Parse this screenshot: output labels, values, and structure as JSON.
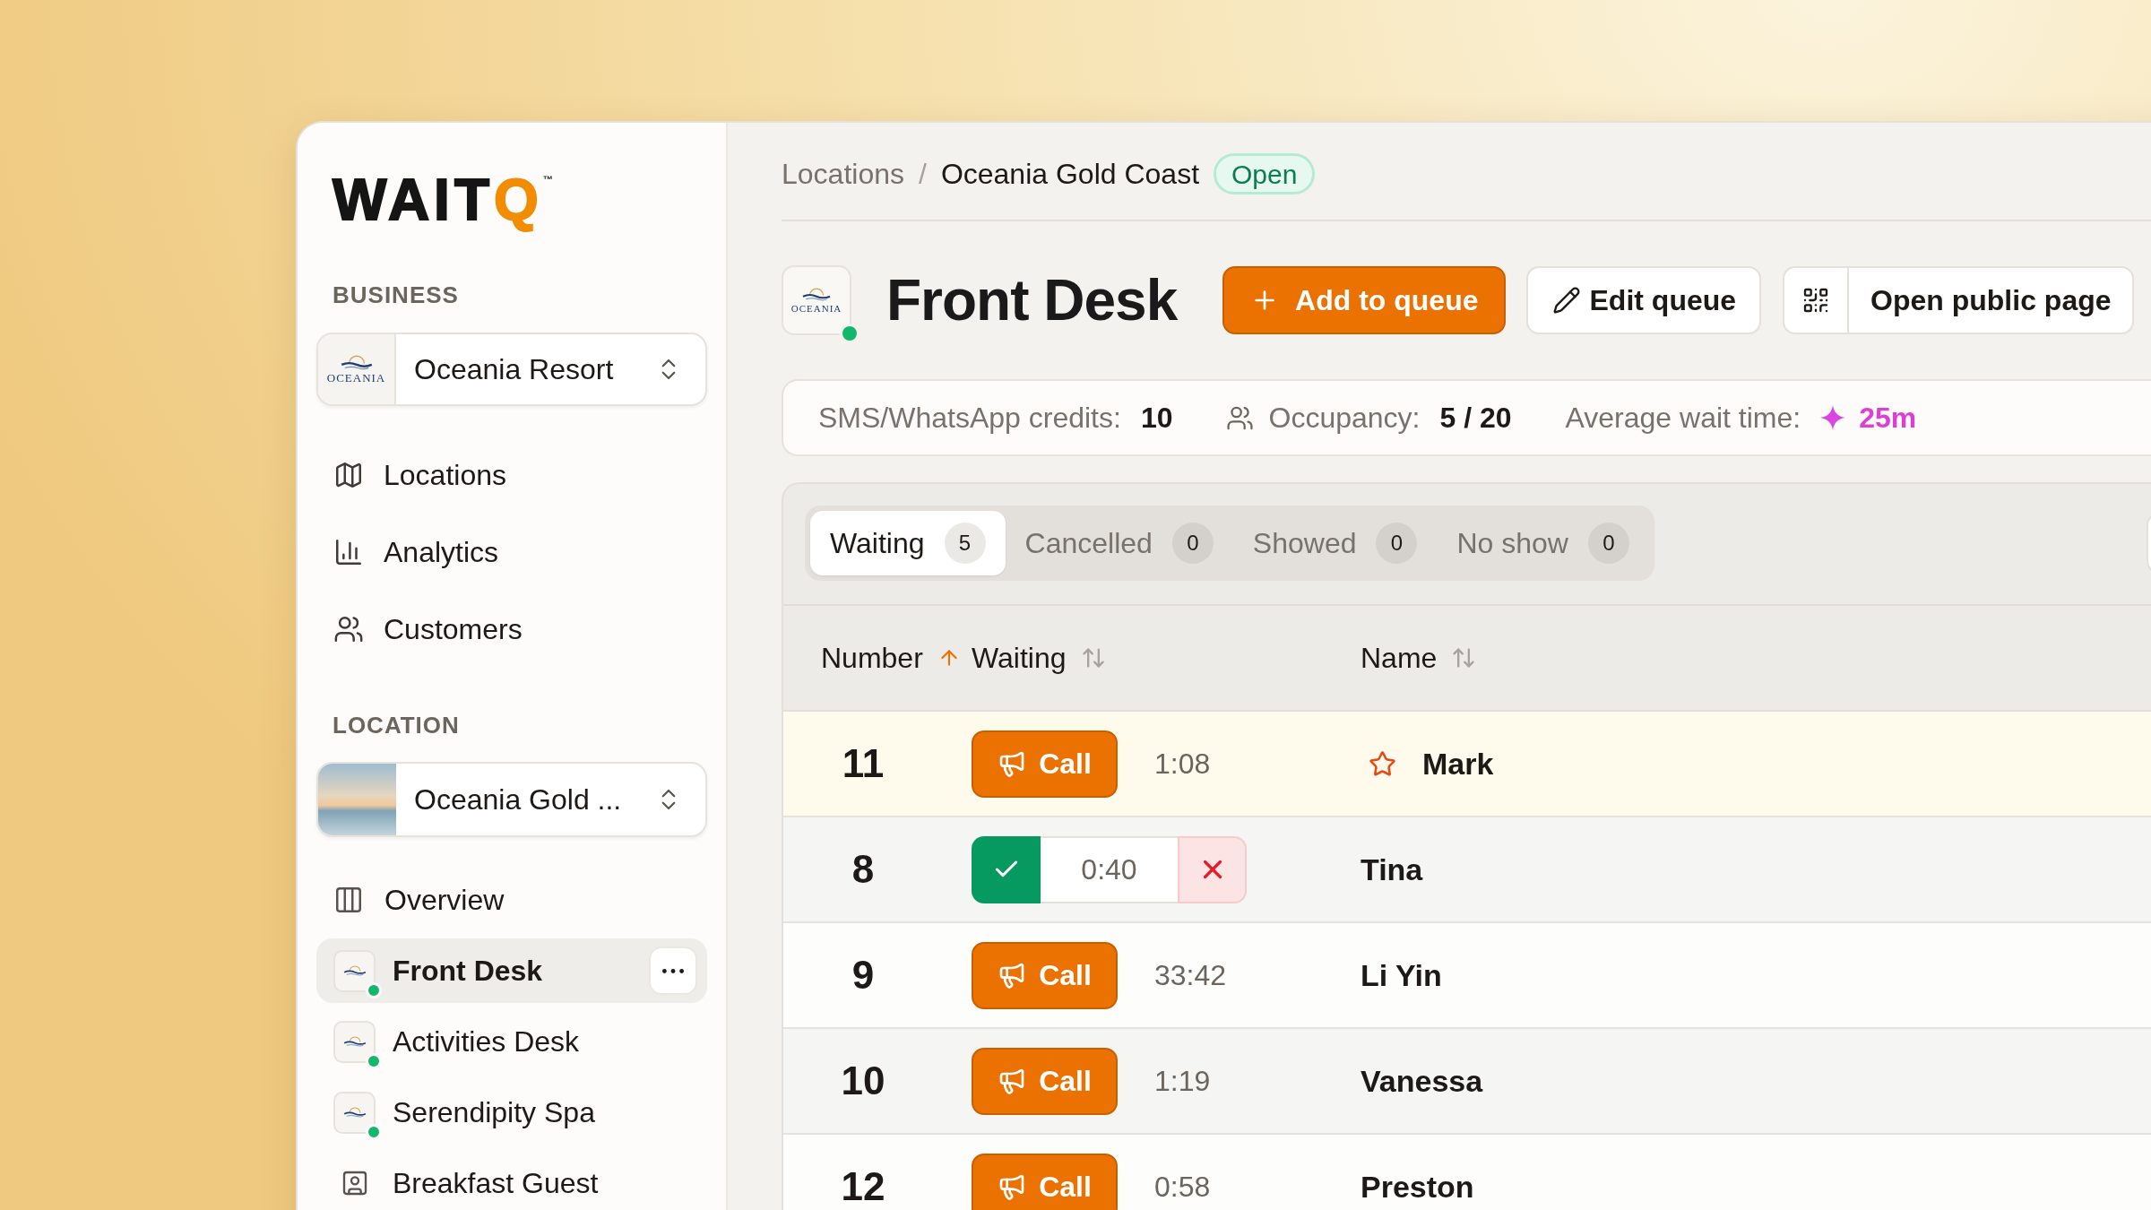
{
  "sidebar": {
    "logo": {
      "text": "WAIT",
      "accent": "Q",
      "mark": "™"
    },
    "business": {
      "label": "BUSINESS",
      "selector": {
        "logo_text": "OCEANIA",
        "value": "Oceania Resort"
      },
      "nav": [
        {
          "label": "Locations",
          "selected": false
        },
        {
          "label": "Analytics",
          "selected": false
        },
        {
          "label": "Customers",
          "selected": false
        }
      ]
    },
    "location": {
      "label": "LOCATION",
      "selector": {
        "value": "Oceania Gold ..."
      },
      "nav": [
        {
          "label": "Overview",
          "kind": "page",
          "selected": false
        },
        {
          "label": "Front Desk",
          "kind": "queue",
          "selected": true,
          "online": true
        },
        {
          "label": "Activities Desk",
          "kind": "queue",
          "selected": false,
          "online": true
        },
        {
          "label": "Serendipity Spa",
          "kind": "queue",
          "selected": false,
          "online": true
        },
        {
          "label": "Breakfast Guest",
          "kind": "list",
          "selected": false
        }
      ]
    }
  },
  "main": {
    "breadcrumb": {
      "items": [
        "Locations",
        "Oceania Gold Coast"
      ],
      "separator": "/",
      "status": "Open"
    },
    "header": {
      "logo_text": "OCEANIA",
      "online": true,
      "title": "Front Desk",
      "buttons": [
        {
          "label": "Add to queue",
          "kind": "primary"
        },
        {
          "label": "Edit queue",
          "kind": "secondary"
        },
        {
          "label": "Open public page",
          "kind": "split"
        }
      ]
    },
    "stats": [
      {
        "label": "SMS/WhatsApp credits:",
        "value": "10",
        "kind": "plain"
      },
      {
        "label": "Occupancy:",
        "value": "5 / 20",
        "kind": "people"
      },
      {
        "label": "Average wait time:",
        "value": "25m",
        "kind": "highlight"
      }
    ],
    "queue": {
      "tabs": [
        {
          "label": "Waiting",
          "count": "5",
          "selected": true
        },
        {
          "label": "Cancelled",
          "count": "0",
          "selected": false
        },
        {
          "label": "Showed",
          "count": "0",
          "selected": false
        },
        {
          "label": "No show",
          "count": "0",
          "selected": false
        }
      ],
      "columns": [
        {
          "label": "Number",
          "sorted": true
        },
        {
          "label": "Waiting",
          "sorted": false
        },
        {
          "label": "Name",
          "sorted": false
        }
      ],
      "rows": [
        {
          "number": "11",
          "kind": "waiting",
          "action": "Call",
          "time": "1:08",
          "name": "Mark",
          "starred": true
        },
        {
          "number": "8",
          "kind": "called",
          "call_timer": "0:40",
          "name": "Tina",
          "starred": false
        },
        {
          "number": "9",
          "kind": "waiting",
          "action": "Call",
          "time": "33:42",
          "name": "Li Yin",
          "starred": false
        },
        {
          "number": "10",
          "kind": "waiting",
          "action": "Call",
          "time": "1:19",
          "name": "Vanessa",
          "starred": false
        },
        {
          "number": "12",
          "kind": "waiting",
          "action": "Call",
          "time": "0:58",
          "name": "Preston",
          "starred": false
        }
      ]
    }
  }
}
